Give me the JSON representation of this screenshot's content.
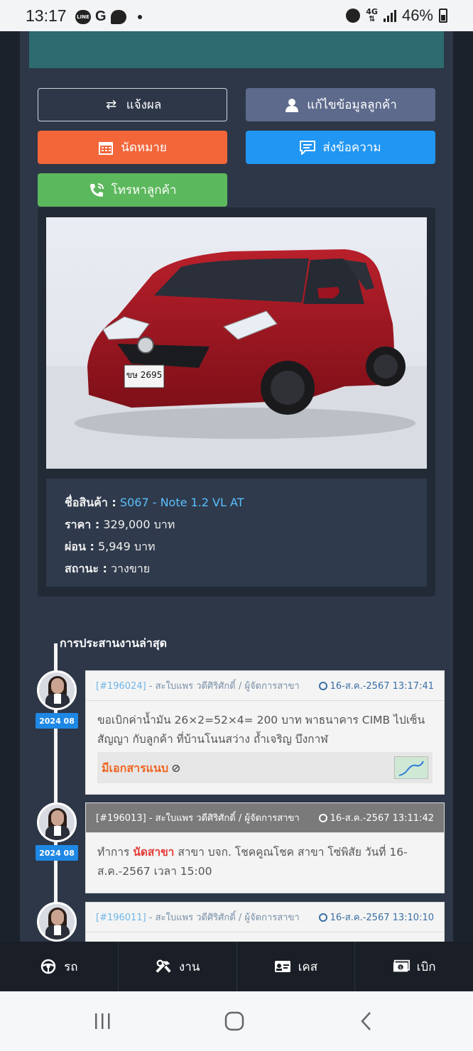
{
  "status_bar": {
    "time": "13:17",
    "notification_icons": [
      "line-icon",
      "google-icon",
      "chat-icon",
      "dot-icon"
    ],
    "network": "4G",
    "battery": "46%"
  },
  "actions": {
    "report": "แจ้งผล",
    "edit_customer": "แก้ไขข้อมูลลูกค้า",
    "appointment": "นัดหมาย",
    "send_message": "ส่งข้อความ",
    "call_customer": "โทรหาลูกค้า"
  },
  "product": {
    "plate": "ขษ 2695",
    "name_label": "ชื่อสินค้า :",
    "name_value": "S067 - Note 1.2 VL AT",
    "price_label": "ราคา :",
    "price_value": "329,000 บาท",
    "installment_label": "ผ่อน :",
    "installment_value": "5,949 บาท",
    "status_label": "สถานะ :",
    "status_value": "วางขาย"
  },
  "timeline": {
    "title": "การประสานงานล่าสุด",
    "entries": [
      {
        "date_badge": "2024 08",
        "id": "[#196024]",
        "author": " - สะใบแพร วดีศิริศักดิ์ / ผู้จัดการสาขา",
        "timestamp": "16-ส.ค.-2567 13:17:41",
        "body": "ขอเบิกค่าน้ำมัน 26×2=52×4= 200 บาท พาธนาคาร CIMB ไปเซ็นสัญญา กับลูกค้า ที่บ้านโนนสว่าง ถ้ำเจริญ บึงกาฬ",
        "attachment_label": "มีเอกสารแนบ"
      },
      {
        "date_badge": "2024 08",
        "id": "[#196013]",
        "author": " - สะใบแพร วดีศิริศักดิ์ / ผู้จัดการสาขา",
        "timestamp": "16-ส.ค.-2567 13:11:42",
        "body_prefix": "ทำการ ",
        "body_highlight": "นัดสาขา",
        "body_suffix": " สาขา บจก. โชคคูณโชค สาขา โซ่พิสัย วันที่ 16-ส.ค.-2567 เวลา 15:00"
      },
      {
        "id": "[#196011]",
        "author": " - สะใบแพร วดีศิริศักดิ์ / ผู้จัดการสาขา",
        "timestamp": "16-ส.ค.-2567 13:10:10"
      }
    ]
  },
  "bottom_nav": {
    "car": "รถ",
    "work": "งาน",
    "case": "เคส",
    "withdraw": "เบิก"
  },
  "colors": {
    "report_border": "#cfd6de",
    "edit": "#5d6a8c",
    "appointment": "#f2663a",
    "message": "#2196f3",
    "call": "#5cb85c",
    "badge": "#1e88e5",
    "highlight": "#e53935",
    "attachment": "#f0641f"
  }
}
